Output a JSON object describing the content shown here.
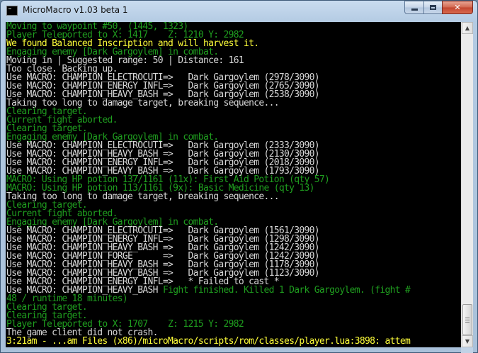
{
  "window": {
    "title": "MicroMacro v1.03 beta 1",
    "icon": "console-icon"
  },
  "caption": {
    "minimize_icon": "minimize-icon",
    "maximize_icon": "maximize-icon",
    "close_label": "✕"
  },
  "scrollbar": {
    "up_arrow": "▲",
    "down_arrow": "▼"
  },
  "colors": {
    "green": "#1f9e1f",
    "white": "#d8d8d8",
    "yellow": "#ffff3a"
  },
  "console": {
    "lines": [
      {
        "text": "Moving to waypoint #50, (1445, 1323)",
        "color": "green"
      },
      {
        "text": "Player Teleported to X: 1417    Z: 1210 Y: 2982",
        "color": "green"
      },
      {
        "text": "We found Balanced Inscription and will harvest it.",
        "color": "yellow"
      },
      {
        "text": "Engaging enemy [Dark Gargoylem] in combat.",
        "color": "green"
      },
      {
        "text": "Moving in | Suggested range: 50 | Distance: 161",
        "color": "white"
      },
      {
        "text": "Too close. Backing up.",
        "color": "white"
      },
      {
        "text": "Use MACRO: CHAMPION_ELECTROCUTI=>   Dark Gargoylem (2978/3090)",
        "color": "white"
      },
      {
        "text": "Use MACRO: CHAMPION_ENERGY_INFL=>   Dark Gargoylem (2765/3090)",
        "color": "white"
      },
      {
        "text": "Use MACRO: CHAMPION_HEAVY_BASH =>   Dark Gargoylem (2538/3090)",
        "color": "white"
      },
      {
        "text": "Taking too long to damage target, breaking sequence...",
        "color": "white"
      },
      {
        "text": "Clearing target.",
        "color": "green"
      },
      {
        "text": "Current fight aborted.",
        "color": "green"
      },
      {
        "text": "Clearing target.",
        "color": "green"
      },
      {
        "text": "Engaging enemy [Dark Gargoylem] in combat.",
        "color": "green"
      },
      {
        "text": "Use MACRO: CHAMPION_ELECTROCUTI=>   Dark Gargoylem (2333/3090)",
        "color": "white"
      },
      {
        "text": "Use MACRO: CHAMPION_HEAVY_BASH =>   Dark Gargoylem (2130/3090)",
        "color": "white"
      },
      {
        "text": "Use MACRO: CHAMPION_ENERGY_INFL=>   Dark Gargoylem (2018/3090)",
        "color": "white"
      },
      {
        "text": "Use MACRO: CHAMPION_HEAVY_BASH =>   Dark Gargoylem (1793/3090)",
        "color": "white"
      },
      {
        "text": "MACRO: Using HP potion 137/1161 (11x): First Aid Potion (qty 57)",
        "color": "green"
      },
      {
        "text": "MACRO: Using HP potion 113/1161 (9x): Basic Medicine (qty 13)",
        "color": "green"
      },
      {
        "text": "Taking too long to damage target, breaking sequence...",
        "color": "white"
      },
      {
        "text": "Clearing target.",
        "color": "green"
      },
      {
        "text": "Current fight aborted.",
        "color": "green"
      },
      {
        "text": "Engaging enemy [Dark Gargoylem] in combat.",
        "color": "green"
      },
      {
        "text": "Use MACRO: CHAMPION_ELECTROCUTI=>   Dark Gargoylem (1561/3090)",
        "color": "white"
      },
      {
        "text": "Use MACRO: CHAMPION_ENERGY_INFL=>   Dark Gargoylem (1298/3090)",
        "color": "white"
      },
      {
        "text": "Use MACRO: CHAMPION_HEAVY_BASH =>   Dark Gargoylem (1242/3090)",
        "color": "white"
      },
      {
        "text": "Use MACRO: CHAMPION_FORGE      =>   Dark Gargoylem (1242/3090)",
        "color": "white"
      },
      {
        "text": "Use MACRO: CHAMPION_HEAVY_BASH =>   Dark Gargoylem (1178/3090)",
        "color": "white"
      },
      {
        "text": "Use MACRO: CHAMPION_HEAVY_BASH =>   Dark Gargoylem (1123/3090)",
        "color": "white"
      },
      {
        "text": "Use MACRO: CHAMPION_ENERGY_INFL=>   * Failed to cast *",
        "color": "white"
      },
      {
        "segments": [
          {
            "text": "Use MACRO: CHAMPION_HEAVY_BASH ",
            "color": "white"
          },
          {
            "text": "Fight finished. Killed 1 Dark Gargoylem. (fight #",
            "color": "green"
          }
        ]
      },
      {
        "text": "48 / runtime 18 minutes)",
        "color": "green"
      },
      {
        "text": "Clearing target.",
        "color": "green"
      },
      {
        "text": "Clearing target.",
        "color": "green"
      },
      {
        "text": "Player Teleported to X: 1707    Z: 1215 Y: 2982",
        "color": "green"
      },
      {
        "text": "The game client did not crash.",
        "color": "white"
      },
      {
        "text": "3:21am - ...am Files (x86)/microMacro/scripts/rom/classes/player.lua:3898: attem",
        "color": "yellow"
      }
    ]
  }
}
